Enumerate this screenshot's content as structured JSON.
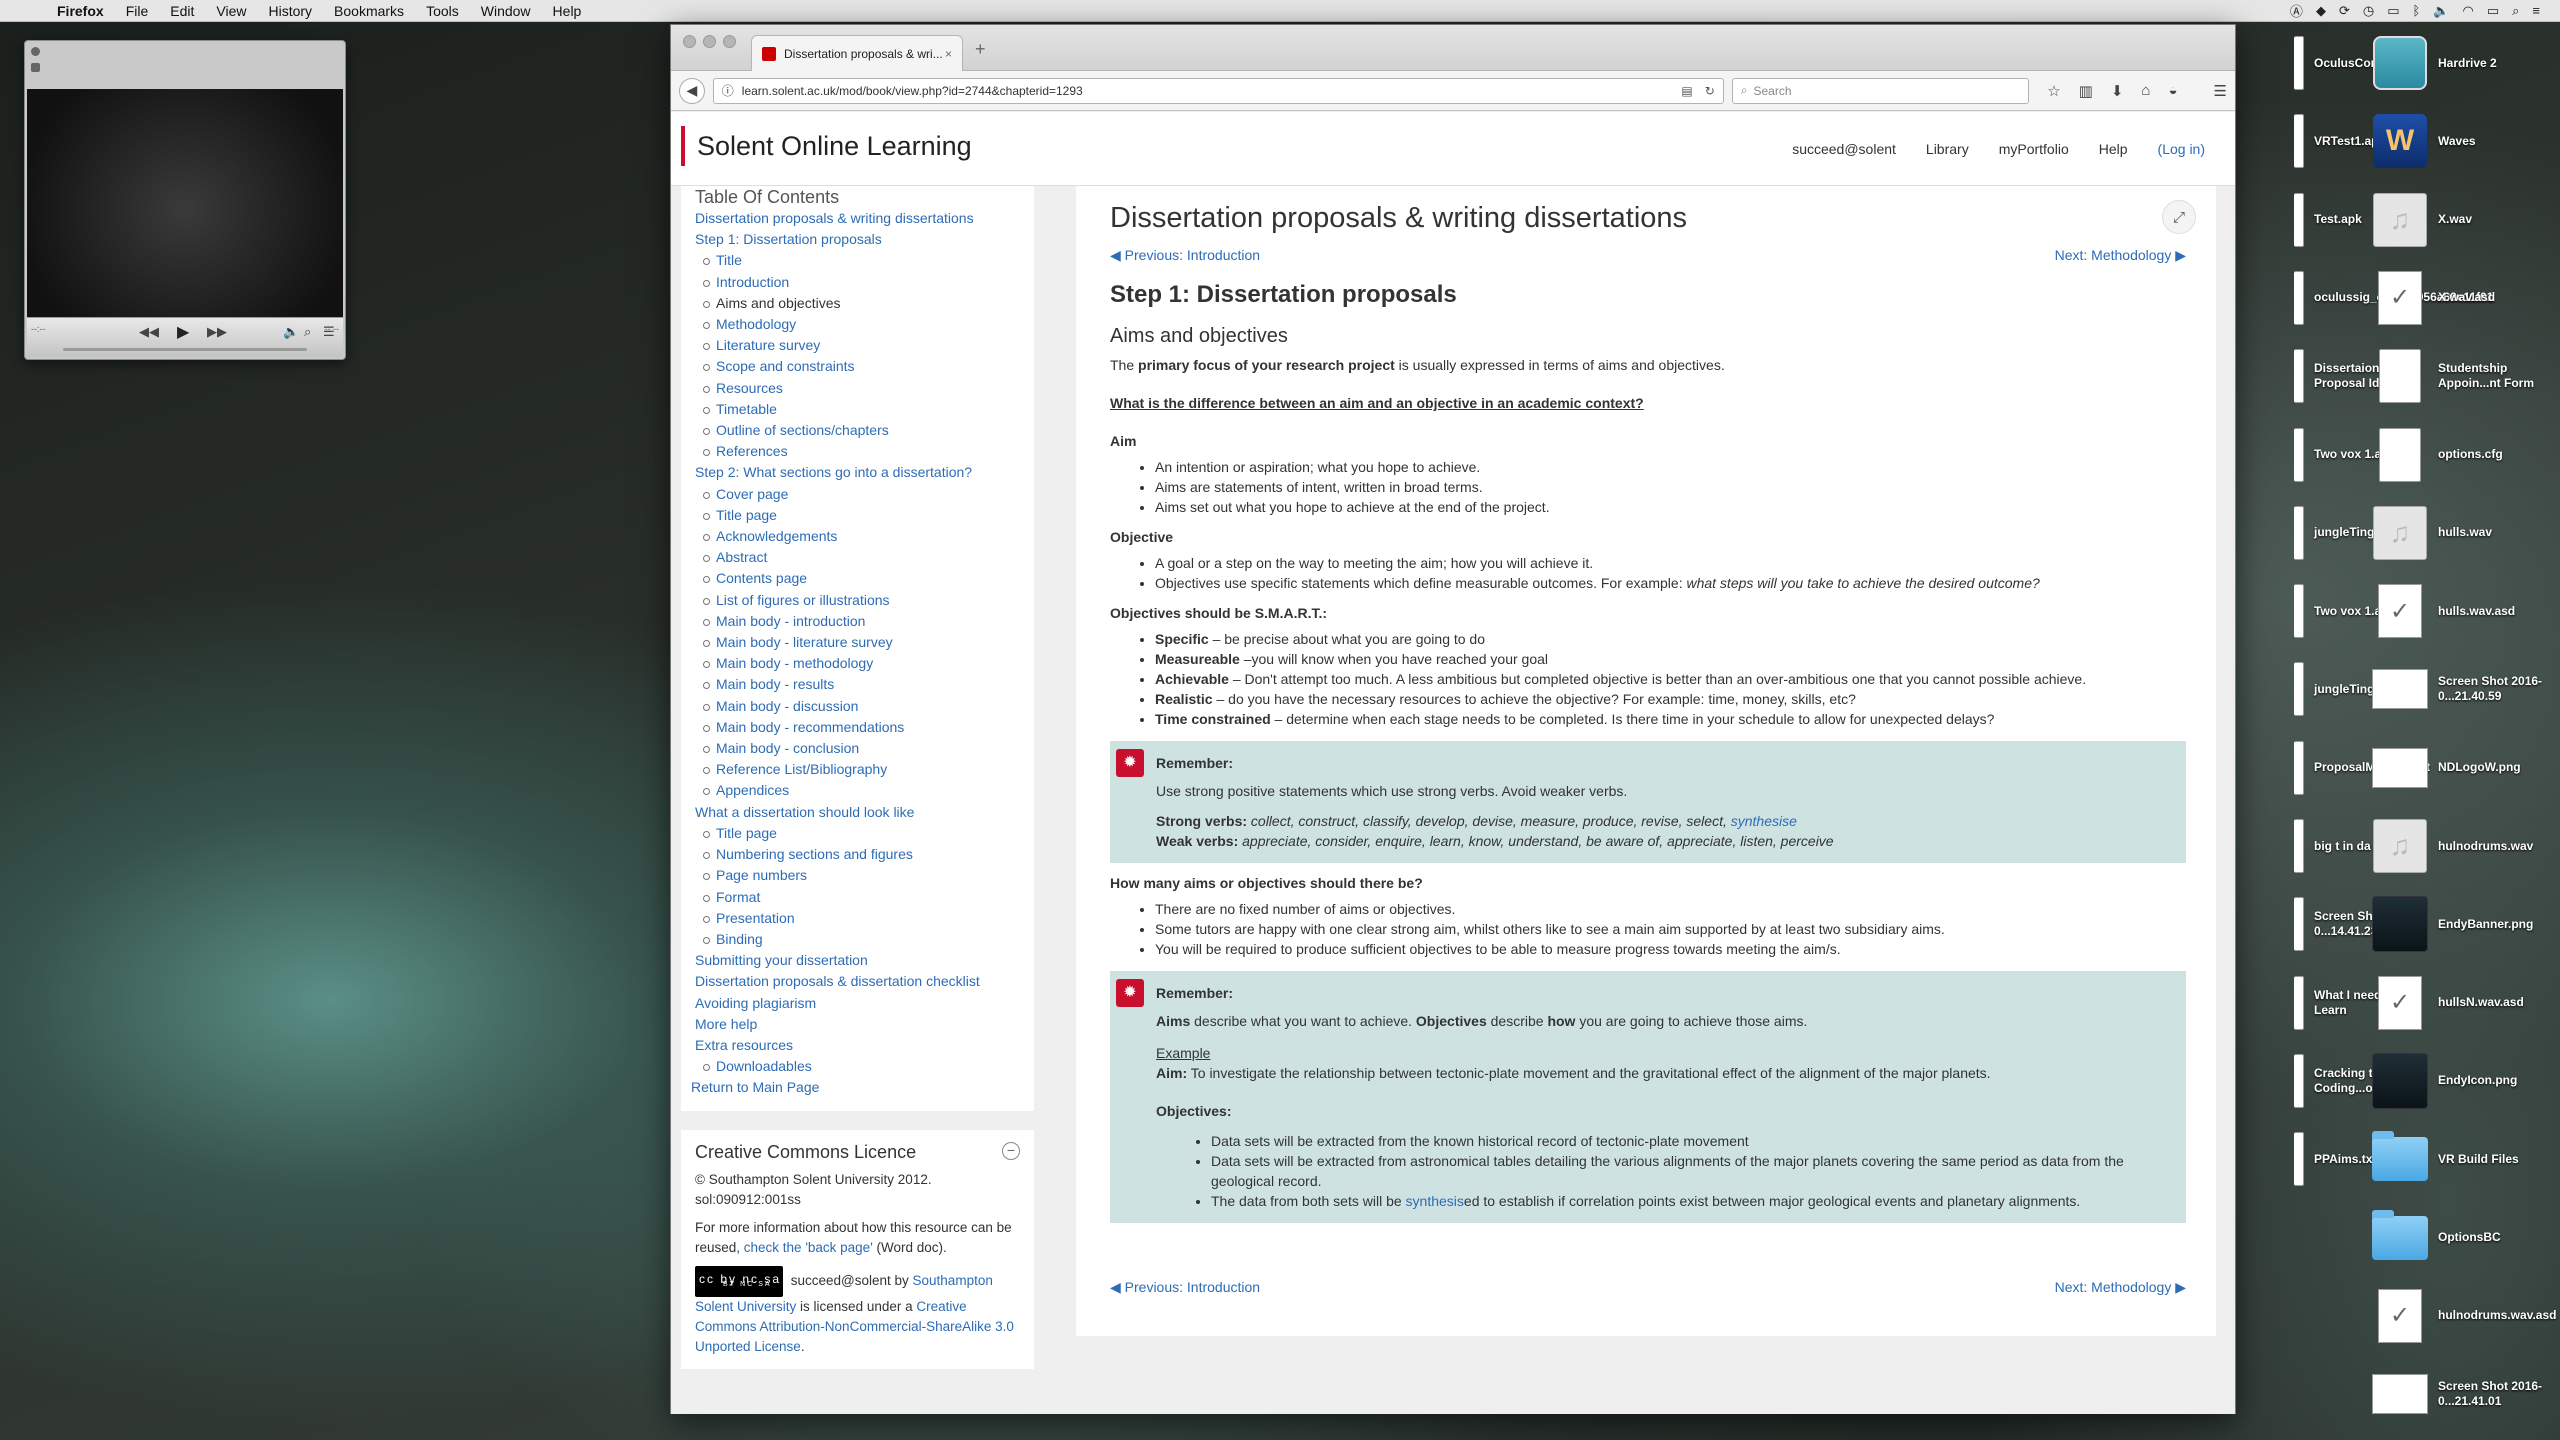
{
  "menubar": {
    "app": "Firefox",
    "items": [
      "File",
      "Edit",
      "View",
      "History",
      "Bookmarks",
      "Tools",
      "Window",
      "Help"
    ]
  },
  "desktop": {
    "icons": [
      {
        "label": "OculusConfigUtil",
        "kind": "file-narrow"
      },
      {
        "label": "Hardrive 2",
        "kind": "drive"
      },
      {
        "label": "VRTest1.apk",
        "kind": "file-narrow"
      },
      {
        "label": "Waves",
        "kind": "waves"
      },
      {
        "label": "Test.apk",
        "kind": "file-narrow"
      },
      {
        "label": "X.wav",
        "kind": "audio"
      },
      {
        "label": "oculussig_ce0516056a69e11f01",
        "kind": "file-narrow"
      },
      {
        "label": "X.wav.asd",
        "kind": "check"
      },
      {
        "label": "Dissertaion Proposal Ideas",
        "kind": "file-narrow"
      },
      {
        "label": "Studentship Appoin...nt Form",
        "kind": "file"
      },
      {
        "label": "Two vox 1.aif.asd",
        "kind": "file-narrow"
      },
      {
        "label": "options.cfg",
        "kind": "file"
      },
      {
        "label": "jungleTing.wav",
        "kind": "file-narrow"
      },
      {
        "label": "hulls.wav",
        "kind": "audio"
      },
      {
        "label": "Two vox 1.aif",
        "kind": "file-narrow"
      },
      {
        "label": "hulls.wav.asd",
        "kind": "check"
      },
      {
        "label": "jungleTing.wav.asd",
        "kind": "file-narrow"
      },
      {
        "label": "Screen Shot 2016-0...21.40.59",
        "kind": "shot"
      },
      {
        "label": "ProposalMockUp.txt",
        "kind": "file-narrow"
      },
      {
        "label": "NDLogoW.png",
        "kind": "shot"
      },
      {
        "label": "big t in da house",
        "kind": "file-narrow"
      },
      {
        "label": "hulnodrums.wav",
        "kind": "audio"
      },
      {
        "label": "Screen Shot 2016-0...14.41.23",
        "kind": "file-narrow"
      },
      {
        "label": "EndyBanner.png",
        "kind": "dark"
      },
      {
        "label": "What I need to Learn",
        "kind": "file-narrow"
      },
      {
        "label": "hullsN.wav.asd",
        "kind": "check"
      },
      {
        "label": "Cracking the Coding...ons.pdf",
        "kind": "file-narrow"
      },
      {
        "label": "EndyIcon.png",
        "kind": "dark"
      },
      {
        "label": "PPAims.txt",
        "kind": "file-narrow"
      },
      {
        "label": "VR Build Files",
        "kind": "folder"
      },
      {
        "label": "",
        "kind": "none"
      },
      {
        "label": "OptionsBC",
        "kind": "folder"
      },
      {
        "label": "",
        "kind": "none"
      },
      {
        "label": "hulnodrums.wav.asd",
        "kind": "check"
      },
      {
        "label": "",
        "kind": "none"
      },
      {
        "label": "Screen Shot 2016-0...21.41.01",
        "kind": "shot"
      }
    ]
  },
  "player": {
    "time_left": "--:--",
    "time_right": "--:--"
  },
  "browser": {
    "tab_title": "Dissertation proposals & wri...",
    "url": "learn.solent.ac.uk/mod/book/view.php?id=2744&chapterid=1293",
    "search_placeholder": "Search"
  },
  "site": {
    "brand": "Solent Online Learning",
    "nav": [
      "succeed@solent",
      "Library",
      "myPortfolio",
      "Help"
    ],
    "login": "(Log in)"
  },
  "toc": {
    "title": "Table Of Contents",
    "items": [
      {
        "label": "Dissertation proposals & writing dissertations",
        "level": 0
      },
      {
        "label": "Step 1: Dissertation proposals",
        "level": 0
      },
      {
        "label": "Title",
        "level": 1
      },
      {
        "label": "Introduction",
        "level": 1
      },
      {
        "label": "Aims and objectives",
        "level": 1,
        "current": true
      },
      {
        "label": "Methodology",
        "level": 1
      },
      {
        "label": "Literature survey",
        "level": 1
      },
      {
        "label": "Scope and constraints",
        "level": 1
      },
      {
        "label": "Resources",
        "level": 1
      },
      {
        "label": "Timetable",
        "level": 1
      },
      {
        "label": "Outline of sections/chapters",
        "level": 1
      },
      {
        "label": "References",
        "level": 1
      },
      {
        "label": "Step 2: What sections go into a dissertation?",
        "level": 0
      },
      {
        "label": "Cover page",
        "level": 1
      },
      {
        "label": "Title page",
        "level": 1
      },
      {
        "label": "Acknowledgements",
        "level": 1
      },
      {
        "label": "Abstract",
        "level": 1
      },
      {
        "label": "Contents page",
        "level": 1
      },
      {
        "label": "List of figures or illustrations",
        "level": 1
      },
      {
        "label": "Main body - introduction",
        "level": 1
      },
      {
        "label": "Main body - literature survey",
        "level": 1
      },
      {
        "label": "Main body - methodology",
        "level": 1
      },
      {
        "label": "Main body - results",
        "level": 1
      },
      {
        "label": "Main body - discussion",
        "level": 1
      },
      {
        "label": "Main body - recommendations",
        "level": 1
      },
      {
        "label": "Main body - conclusion",
        "level": 1
      },
      {
        "label": "Reference List/Bibliography",
        "level": 1
      },
      {
        "label": "Appendices",
        "level": 1
      },
      {
        "label": "What a dissertation should look like",
        "level": 0
      },
      {
        "label": "Title page",
        "level": 1
      },
      {
        "label": "Numbering sections and figures",
        "level": 1
      },
      {
        "label": "Page numbers",
        "level": 1
      },
      {
        "label": "Format",
        "level": 1
      },
      {
        "label": "Presentation",
        "level": 1
      },
      {
        "label": "Binding",
        "level": 1
      },
      {
        "label": "Submitting your dissertation",
        "level": 0
      },
      {
        "label": "Dissertation proposals & dissertation checklist",
        "level": 0
      },
      {
        "label": "Avoiding plagiarism",
        "level": 0
      },
      {
        "label": "More help",
        "level": 0
      },
      {
        "label": "Extra resources",
        "level": 0
      },
      {
        "label": "Downloadables",
        "level": 1
      }
    ],
    "return": "Return to Main Page"
  },
  "cc": {
    "title": "Creative Commons Licence",
    "line1": "© Southampton Solent University 2012. sol:090912:001ss",
    "line2a": "For more information about how this resource can be reused, ",
    "line2link": "check the 'back page'",
    "line2b": " (Word doc).",
    "badge": "cc by nc sa",
    "badge_small": "BY NC SA",
    "line3a": " succeed@solent by ",
    "line3link": "Southampton Solent University",
    "line3b": " is licensed under a ",
    "line3link2": "Creative Commons Attribution-NonCommercial-ShareAlike 3.0 Unported License",
    "line3c": "."
  },
  "main": {
    "title": "Dissertation proposals & writing dissertations",
    "prev_label": "Previous: ",
    "prev_target": "Introduction",
    "next_label": "Next: ",
    "next_target": "Methodology",
    "step": "Step 1: Dissertation proposals",
    "section": "Aims and objectives",
    "intro_a": "The ",
    "intro_b": "primary focus of your research project",
    "intro_c": " is usually expressed in terms of aims and objectives.",
    "question": "What is the difference between an aim and an objective in an academic context?",
    "aim_h": "Aim",
    "aim_items": [
      "An intention or aspiration; what you hope to achieve.",
      "Aims are statements of intent, written in broad terms.",
      "Aims set out what you hope to achieve at the end of the project."
    ],
    "obj_h": "Objective",
    "obj_item1": "A goal or a step on the way to meeting the aim; how you will achieve it.",
    "obj_item2a": "Objectives use specific statements which define measurable outcomes. For example: ",
    "obj_item2b": "what steps will you take to achieve the desired outcome?",
    "smart_h": "Objectives should be S.M.A.R.T.:",
    "smart": [
      {
        "k": "Specific",
        "v": " – be precise about what you are going to do"
      },
      {
        "k": "Measureable",
        "v": " –you will know when you have reached your goal"
      },
      {
        "k": "Achievable",
        "v": " – Don't attempt too much. A less ambitious but completed objective is better than an over-ambitious one that you cannot possible achieve."
      },
      {
        "k": "Realistic",
        "v": " – do you have the necessary resources to achieve the objective? For example: time, money, skills, etc?"
      },
      {
        "k": "Time constrained",
        "v": " – determine when each stage needs to be completed. Is there time in your schedule to allow for unexpected delays?"
      }
    ],
    "rem1": {
      "title": "Remember:",
      "p1": "Use strong positive statements which use strong verbs. Avoid weaker verbs.",
      "strong_k": "Strong verbs:",
      "strong_v": " collect, construct, classify, develop, devise, measure, produce, revise, select, ",
      "strong_link": "synthesise",
      "weak_k": "Weak verbs:",
      "weak_v": " appreciate, consider, enquire, learn, know, understand, be aware of, appreciate, listen, perceive"
    },
    "howmany_h": "How many aims or objectives should there be?",
    "howmany": [
      "There are no fixed number of aims or objectives.",
      "Some tutors are happy with one clear strong aim, whilst others like to see a main aim supported by at least two subsidiary aims.",
      "You will be required to produce sufficient objectives to be able to measure progress towards meeting the aim/s."
    ],
    "rem2": {
      "title": "Remember:",
      "p1a": "Aims",
      "p1b": " describe what you want to achieve. ",
      "p1c": "Objectives",
      "p1d": " describe ",
      "p1e": "how",
      "p1f": " you are going to achieve those aims.",
      "example": "Example",
      "aim_k": "Aim:",
      "aim_v": " To investigate the relationship between tectonic-plate movement and the gravitational effect of the alignment of the major planets.",
      "obj_k": "Objectives:",
      "obj1": "Data sets will be extracted from the known historical record of tectonic-plate movement",
      "obj2": "Data sets will be extracted from astronomical tables detailing the various alignments of the major planets covering the same period as data from the geological record.",
      "obj3a": "The data from both sets will be ",
      "obj3link": "synthesis",
      "obj3b": "ed to establish if correlation points exist between major geological events and planetary alignments."
    }
  }
}
